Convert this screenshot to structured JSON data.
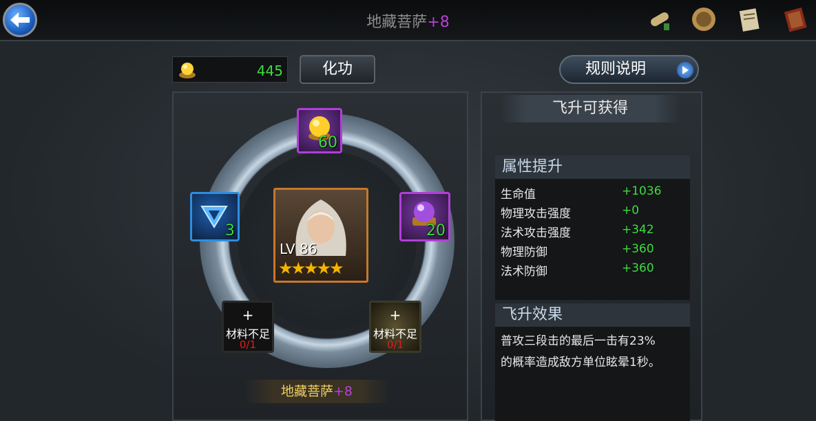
{
  "header": {
    "title": "地藏菩萨",
    "title_plus": "+8",
    "icons": [
      "scroll-icon",
      "medal-icon",
      "notebook-icon",
      "book-icon"
    ]
  },
  "currency": {
    "icon": "gold-orb-icon",
    "value": "445"
  },
  "buttons": {
    "huagong": "化功",
    "rules": "规则说明"
  },
  "slots": {
    "top": {
      "value": "60",
      "icon": "gold-orb-icon"
    },
    "left": {
      "value": "3",
      "icon": "blue-triangle-icon"
    },
    "right": {
      "value": "20",
      "icon": "purple-orb-icon"
    },
    "bottom_left": {
      "label": "材料不足",
      "count": "0/1",
      "plus": "+"
    },
    "bottom_right": {
      "label": "材料不足",
      "count": "0/1",
      "plus": "+"
    }
  },
  "hero": {
    "level": "LV 86",
    "stars": 5
  },
  "name_plate": {
    "name": "地藏菩萨",
    "plus": "+8"
  },
  "panel": {
    "gain_title": "飞升可获得",
    "attr_title": "属性提升",
    "attrs": [
      {
        "label": "生命值",
        "value": "+1036"
      },
      {
        "label": "物理攻击强度",
        "value": "+0"
      },
      {
        "label": "法术攻击强度",
        "value": "+342"
      },
      {
        "label": "物理防御",
        "value": "+360"
      },
      {
        "label": "法术防御",
        "value": "+360"
      }
    ],
    "effect_title": "飞升效果",
    "effect_line1": "普攻三段击的最后一击有23%",
    "effect_line2": "的概率造成敌方单位眩晕1秒。"
  },
  "colors": {
    "green": "#3fdc3f",
    "purple": "#b640d8",
    "red": "#e21b1b",
    "gold": "#f0d060"
  }
}
